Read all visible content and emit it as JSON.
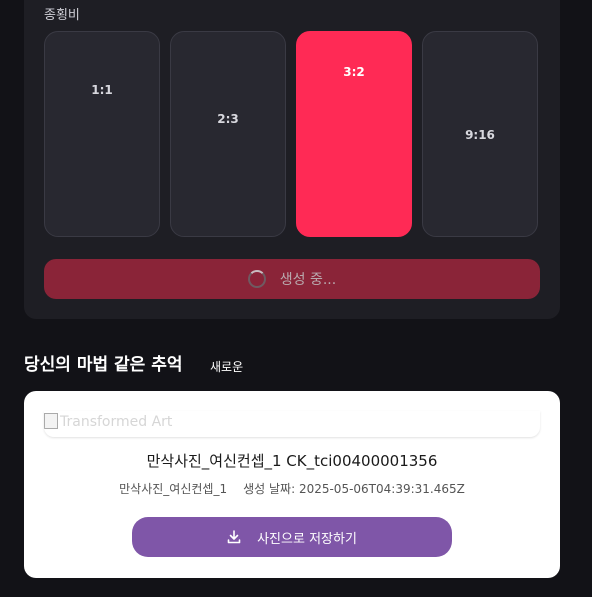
{
  "aspect_ratio": {
    "label": "종횡비",
    "options": [
      {
        "label": "1:1",
        "selected": false
      },
      {
        "label": "2:3",
        "selected": false
      },
      {
        "label": "3:2",
        "selected": true
      },
      {
        "label": "9:16",
        "selected": false
      }
    ]
  },
  "generate_button": {
    "label": "생성 중..."
  },
  "gallery": {
    "heading": "당신의 마법 같은 추억",
    "badge": "새로운",
    "item": {
      "image_alt": "Transformed Art",
      "title": "만삭사진_여신컨셉_1 CK_tci00400001356",
      "category": "만삭사진_여신컨셉_1",
      "created_label": "생성 날짜: 2025-05-06T04:39:31.465Z",
      "save_label": "사진으로 저장하기"
    }
  },
  "colors": {
    "accent": "#ff2a55",
    "save_button": "#7f56a8",
    "background": "#121217"
  }
}
